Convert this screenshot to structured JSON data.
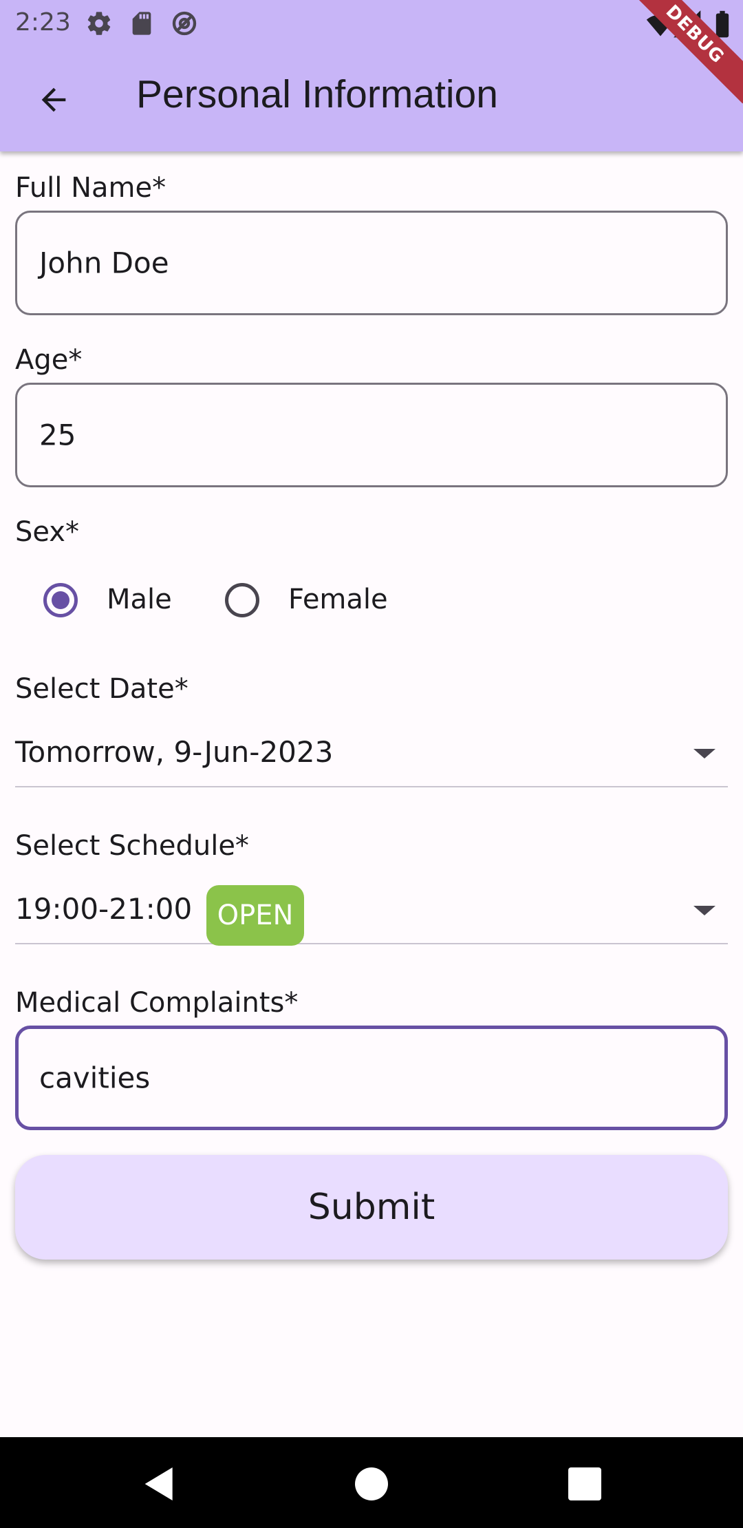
{
  "status_bar": {
    "time": "2:23",
    "left_icons": [
      "settings-icon",
      "sd-card-icon",
      "at-sign-icon"
    ],
    "right_icons": [
      "wifi-icon",
      "signal-icon",
      "battery-icon"
    ]
  },
  "app_bar": {
    "title": "Personal Information",
    "back_icon": "arrow-back-icon",
    "debug_banner": "DEBUG"
  },
  "form": {
    "full_name": {
      "label": "Full Name*",
      "value": "John Doe"
    },
    "age": {
      "label": "Age*",
      "value": "25"
    },
    "sex": {
      "label": "Sex*",
      "options": [
        {
          "label": "Male",
          "selected": true
        },
        {
          "label": "Female",
          "selected": false
        }
      ]
    },
    "date": {
      "label": "Select Date*",
      "value": "Tomorrow, 9-Jun-2023"
    },
    "schedule": {
      "label": "Select Schedule*",
      "value": "19:00-21:00",
      "badge": "OPEN",
      "badge_color": "#8bc34a"
    },
    "complaints": {
      "label": "Medical Complaints*",
      "value": "cavities"
    },
    "submit_label": "Submit"
  },
  "colors": {
    "app_bar": "#c8b5f7",
    "accent": "#6750a4",
    "button": "#e9ddff",
    "background": "#fffbfe"
  },
  "nav_bar": {
    "icons": [
      "back-triangle-icon",
      "home-circle-icon",
      "recents-square-icon"
    ]
  }
}
